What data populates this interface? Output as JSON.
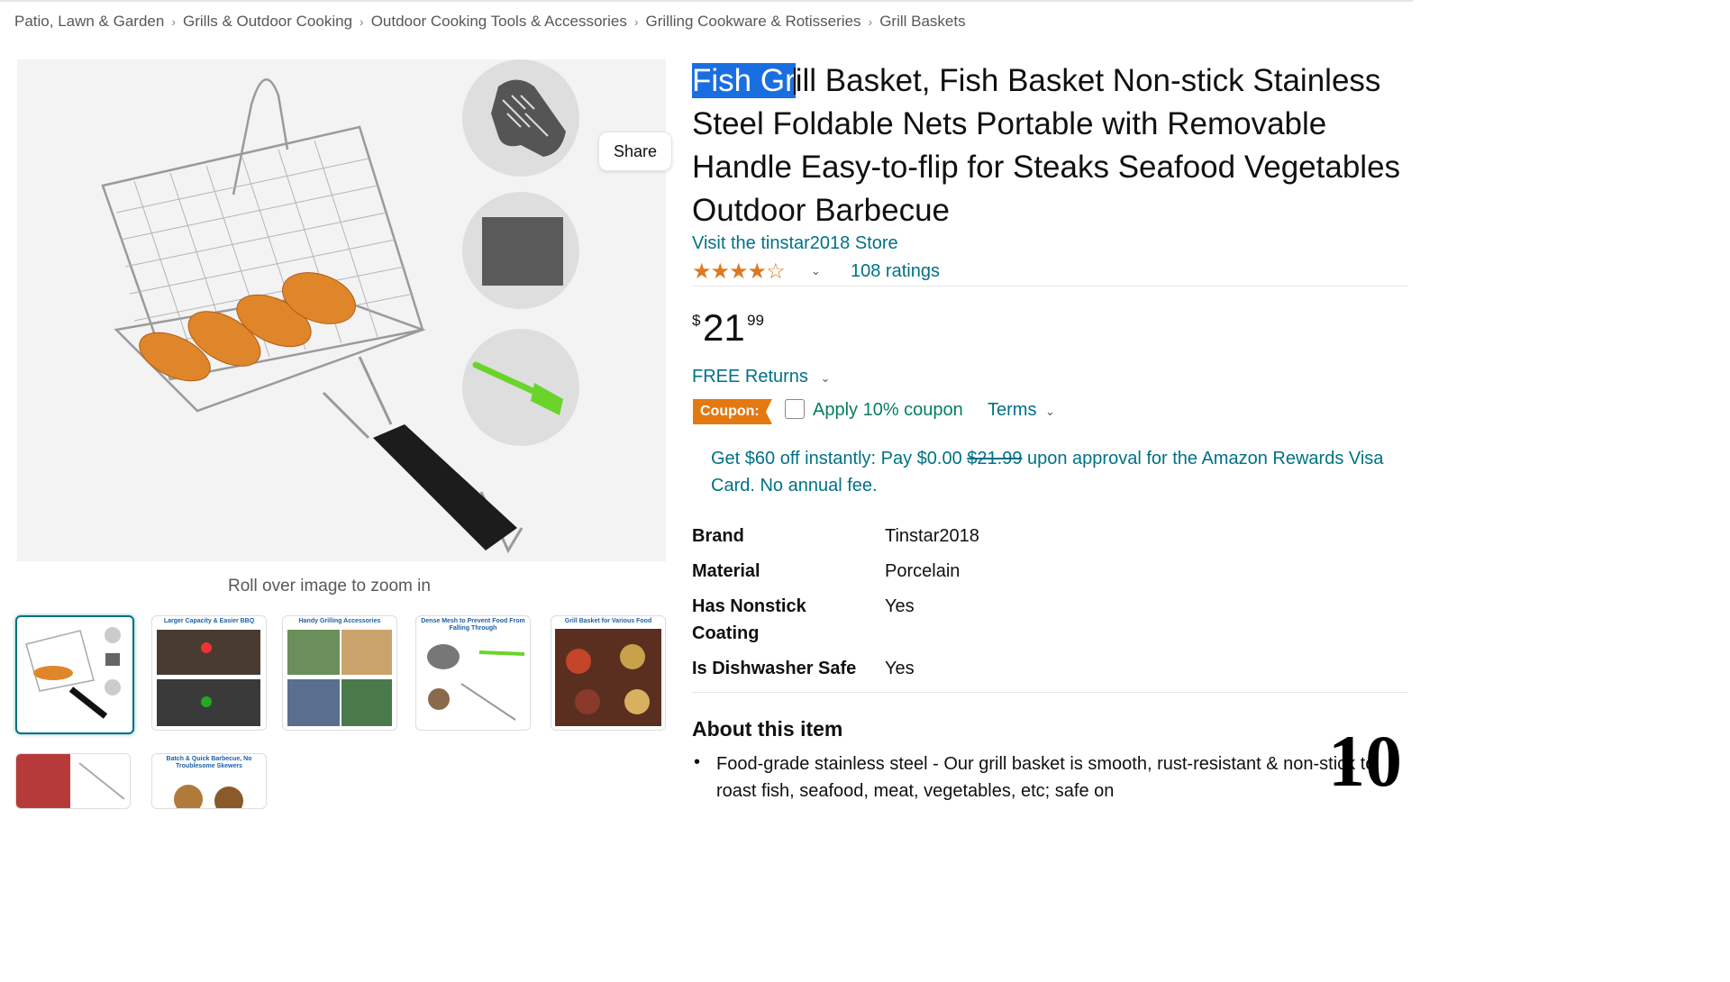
{
  "breadcrumb": [
    "Patio, Lawn & Garden",
    "Grills & Outdoor Cooking",
    "Outdoor Cooking Tools & Accessories",
    "Grilling Cookware & Rotisseries",
    "Grill Baskets"
  ],
  "gallery": {
    "share_label": "Share",
    "zoom_hint": "Roll over image to zoom in",
    "thumbnail_captions": [
      "",
      "Larger Capacity & Easier BBQ",
      "Handy Grilling Accessories",
      "Dense Mesh to Prevent Food From Falling Through",
      "Grill Basket for Various Food",
      "",
      "Batch & Quick Barbecue, No Troublesome Skewers"
    ]
  },
  "product": {
    "title_highlighted": "Fish Gr",
    "title_rest": "ill Basket, Fish Basket Non-stick Stainless Steel Foldable Nets Portable with Removable Handle Easy-to-flip for Steaks Seafood Vegetables Outdoor Barbecue",
    "store_link": "Visit the tinstar2018 Store",
    "rating_stars": 3.5,
    "ratings_count": "108 ratings",
    "price_symbol": "$",
    "price_whole": "21",
    "price_fraction": "99",
    "returns": "FREE Returns",
    "coupon_badge": "Coupon:",
    "coupon_text": "Apply 10% coupon",
    "terms": "Terms",
    "rewards_prefix": "Get $60 off instantly: Pay $0.00 ",
    "rewards_strike": "$21.99",
    "rewards_suffix": " upon approval for the Amazon Rewards Visa Card. No annual fee."
  },
  "specs": [
    {
      "label": "Brand",
      "value": "Tinstar2018"
    },
    {
      "label": "Material",
      "value": "Porcelain"
    },
    {
      "label": "Has Nonstick Coating",
      "value": "Yes"
    },
    {
      "label": "Is Dishwasher Safe",
      "value": "Yes"
    }
  ],
  "about": {
    "heading": "About this item",
    "bullet_1": "Food-grade stainless steel - Our grill basket is smooth, rust-resistant & non-stick to roast fish, seafood, meat, vegetables, etc; safe on"
  },
  "overlay": {
    "page_number": "10"
  },
  "colors": {
    "link": "#007185",
    "coupon_orange": "#e47911",
    "star": "#de7921",
    "coupon_green": "#067d62",
    "selection": "#1a6fe0"
  }
}
